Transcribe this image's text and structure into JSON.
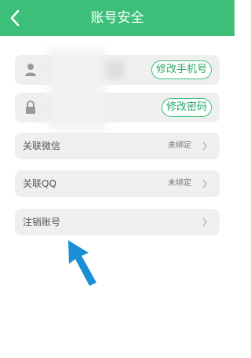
{
  "header": {
    "title": "账号安全",
    "back_icon": "chevron-left-icon",
    "color": "#3dbf79"
  },
  "account": {
    "phone_icon": "user-icon",
    "phone_value": "",
    "change_phone_label": "修改手机号",
    "password_icon": "lock-icon",
    "password_value": "",
    "change_password_label": "修改密码"
  },
  "bindings": {
    "wechat_label": "关联微信",
    "wechat_status": "未绑定",
    "qq_label": "关联QQ",
    "qq_status": "未绑定",
    "cancel_label": "注销账号",
    "chevron_icon": "chevron-right-icon"
  },
  "annotation": {
    "arrow_icon": "pointer-arrow-icon",
    "arrow_color": "#1a8fd6"
  }
}
